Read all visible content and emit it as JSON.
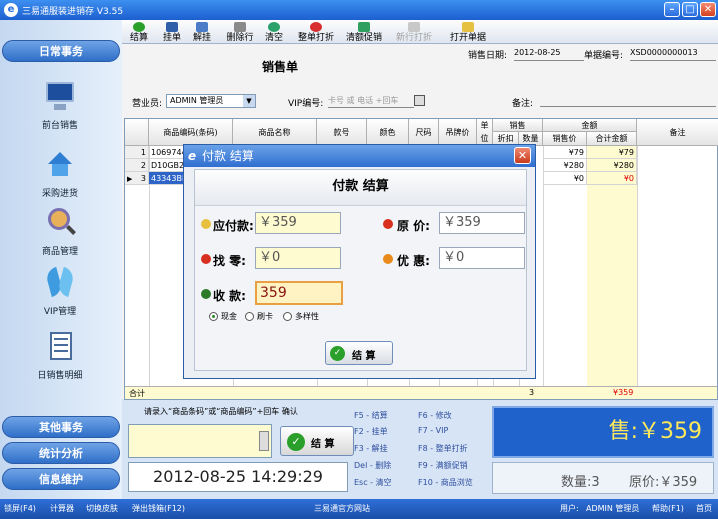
{
  "window": {
    "title": "三易通服装进销存 V3.55"
  },
  "sidebar": {
    "groups": [
      "日常事务",
      "其他事务",
      "统计分析",
      "信息维护"
    ],
    "items": [
      {
        "label": "前台销售",
        "icon": "monitor-icon"
      },
      {
        "label": "采购进货",
        "icon": "house-icon"
      },
      {
        "label": "商品管理",
        "icon": "magnifier-icon"
      },
      {
        "label": "VIP管理",
        "icon": "vip-icon"
      },
      {
        "label": "日销售明细",
        "icon": "notebook-icon"
      }
    ]
  },
  "toolbar": {
    "buttons": [
      "结算",
      "挂单",
      "解挂",
      "删除行",
      "清空",
      "整单打折",
      "清额促销",
      "新行打折",
      "打开单据"
    ]
  },
  "form": {
    "title": "销售单",
    "sale_date_label": "销售日期:",
    "sale_date": "2012-08-25",
    "doc_no_label": "单据编号:",
    "doc_no": "XSD0000000013",
    "clerk_label": "营业员:",
    "clerk": "ADMIN 管理员",
    "vip_label": "VIP编号:",
    "vip_placeholder": "卡号 或 电话 +回车",
    "remark_label": "备注:"
  },
  "grid": {
    "headers": {
      "code": "商品编码(条码)",
      "name": "商品名称",
      "style": "款号",
      "color": "颜色",
      "size": "尺码",
      "tag_price": "吊牌价",
      "unit": "单位",
      "sale": "销售",
      "discount": "折扣",
      "qty": "数量",
      "amount": "金额",
      "price": "销售价",
      "total": "合计金额",
      "remark": "备注"
    },
    "rows": [
      {
        "no": "1",
        "code": "1069744",
        "price": "¥79",
        "total": "¥79"
      },
      {
        "no": "2",
        "code": "D10GB25",
        "price": "¥280",
        "total": "¥280"
      },
      {
        "no": "3",
        "code": "43343BB",
        "price": "¥0",
        "total": "¥0"
      }
    ],
    "footer": {
      "label": "合计",
      "qty": "3",
      "total": "¥359"
    }
  },
  "bottom": {
    "scan_hint": "请录入“商品条码”或“商品编码”+回车 确认",
    "checkout_label": "结 算",
    "datetime": "2012-08-25 14:29:29",
    "fkeys": [
      [
        "F5 - 结算",
        "F6 - 修改"
      ],
      [
        "F2 - 挂单",
        "F7 - VIP"
      ],
      [
        "F3 - 解挂",
        "F8 - 整单打折"
      ],
      [
        "Del - 删除",
        "F9 - 满额促销"
      ],
      [
        "Esc - 清空",
        "F10 - 商品浏览"
      ]
    ],
    "sale_total": "售:￥359",
    "qty_text": "数量:3",
    "orig_price_text": "原价:￥359"
  },
  "status": {
    "left": [
      "锁屏(F4)",
      "计算器",
      "切换皮肤",
      "弹出钱箱(F12)"
    ],
    "center": "三易通官方网站",
    "user_label": "用户:",
    "user": "ADMIN 管理员",
    "help": "帮助(F1)",
    "home": "首页"
  },
  "dialog": {
    "title": "付款 结算",
    "header": "付款 结算",
    "due_label": "应付款:",
    "due": "￥359",
    "orig_label": "原 价:",
    "orig": "￥359",
    "change_label": "找 零:",
    "change": "￥0",
    "discount_label": "优 惠:",
    "discount": "￥0",
    "received_label": "收 款:",
    "received": "359",
    "pay_methods": [
      "现金",
      "刷卡",
      "多样性"
    ],
    "confirm_label": "结 算"
  },
  "colors": {
    "accent_blue": "#2f6fd8",
    "total_red": "#e00000",
    "highlight_yellow": "#fffbd0"
  }
}
